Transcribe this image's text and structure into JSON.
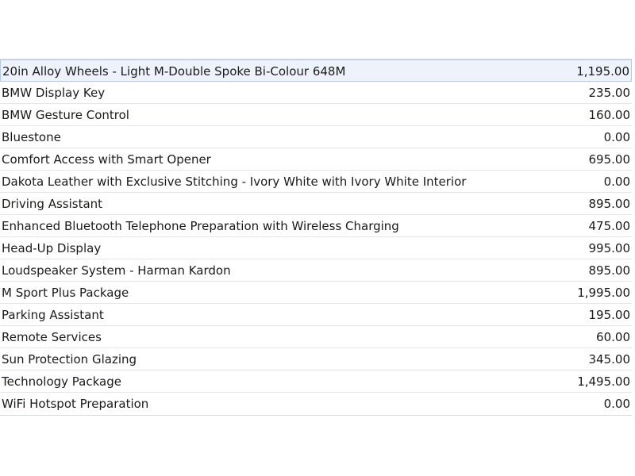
{
  "options": [
    {
      "name": "20in Alloy Wheels - Light M-Double Spoke Bi-Colour 648M",
      "price": "1,195.00",
      "selected": true
    },
    {
      "name": "BMW Display Key",
      "price": "235.00"
    },
    {
      "name": "BMW Gesture Control",
      "price": "160.00"
    },
    {
      "name": "Bluestone",
      "price": "0.00"
    },
    {
      "name": "Comfort Access with Smart Opener",
      "price": "695.00"
    },
    {
      "name": "Dakota Leather with Exclusive Stitching - Ivory White with Ivory White Interior",
      "price": "0.00"
    },
    {
      "name": "Driving Assistant",
      "price": "895.00"
    },
    {
      "name": "Enhanced Bluetooth Telephone Preparation with Wireless Charging",
      "price": "475.00"
    },
    {
      "name": "Head-Up Display",
      "price": "995.00"
    },
    {
      "name": "Loudspeaker System - Harman Kardon",
      "price": "895.00"
    },
    {
      "name": "M Sport Plus Package",
      "price": "1,995.00"
    },
    {
      "name": "Parking Assistant",
      "price": "195.00"
    },
    {
      "name": "Remote Services",
      "price": "60.00"
    },
    {
      "name": "Sun Protection Glazing",
      "price": "345.00"
    },
    {
      "name": "Technology Package",
      "price": "1,495.00"
    },
    {
      "name": "WiFi Hotspot Preparation",
      "price": "0.00"
    }
  ]
}
